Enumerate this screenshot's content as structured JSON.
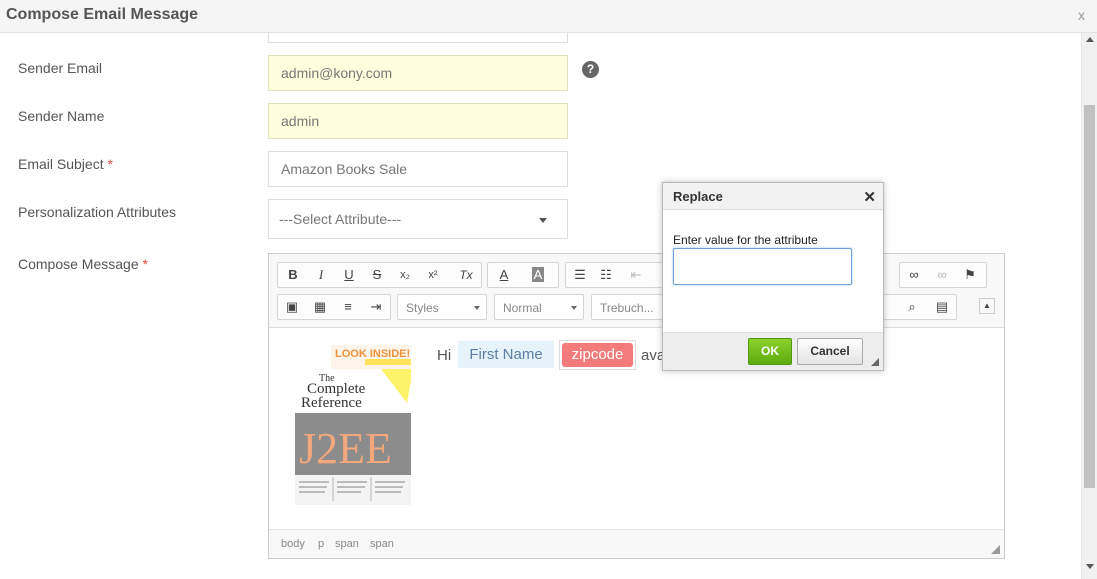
{
  "window": {
    "title": "Compose Email Message",
    "close_label": "x"
  },
  "form": {
    "sender_email": {
      "label": "Sender Email",
      "value": "admin@kony.com",
      "help": "?"
    },
    "sender_name": {
      "label": "Sender Name",
      "value": "admin"
    },
    "email_subject": {
      "label": "Email Subject",
      "required": "*",
      "value": "Amazon Books Sale"
    },
    "personalization": {
      "label": "Personalization Attributes",
      "selected": "---Select Attribute---"
    },
    "compose": {
      "label": "Compose Message",
      "required": "*"
    }
  },
  "toolbar": {
    "buttons_row1": [
      {
        "icon": "bold-icon",
        "glyph": "B"
      },
      {
        "icon": "italic-icon",
        "glyph": "I"
      },
      {
        "icon": "underline-icon",
        "glyph": "U"
      },
      {
        "icon": "strike-icon",
        "glyph": "S"
      },
      {
        "icon": "subscript-icon",
        "glyph": "x₂"
      },
      {
        "icon": "superscript-icon",
        "glyph": "x²"
      },
      {
        "icon": "remove-format-icon",
        "glyph": "Tx"
      }
    ],
    "styles": "Styles",
    "format": "Normal",
    "font": "Trebuch..."
  },
  "message": {
    "hi": "Hi",
    "first_name_tag": "First Name",
    "zipcode_tag": "zipcode",
    "trailing": "ava",
    "book": {
      "look_inside": "LOOK INSIDE!",
      "title_line1": "The",
      "title_line2": "Complete",
      "title_line3": "Reference",
      "big": "J2EE"
    }
  },
  "statusbar": {
    "path": [
      "body",
      "p",
      "span",
      "span"
    ]
  },
  "dialog": {
    "title": "Replace",
    "prompt": "Enter value for the attribute",
    "value": "",
    "ok": "OK",
    "cancel": "Cancel"
  }
}
